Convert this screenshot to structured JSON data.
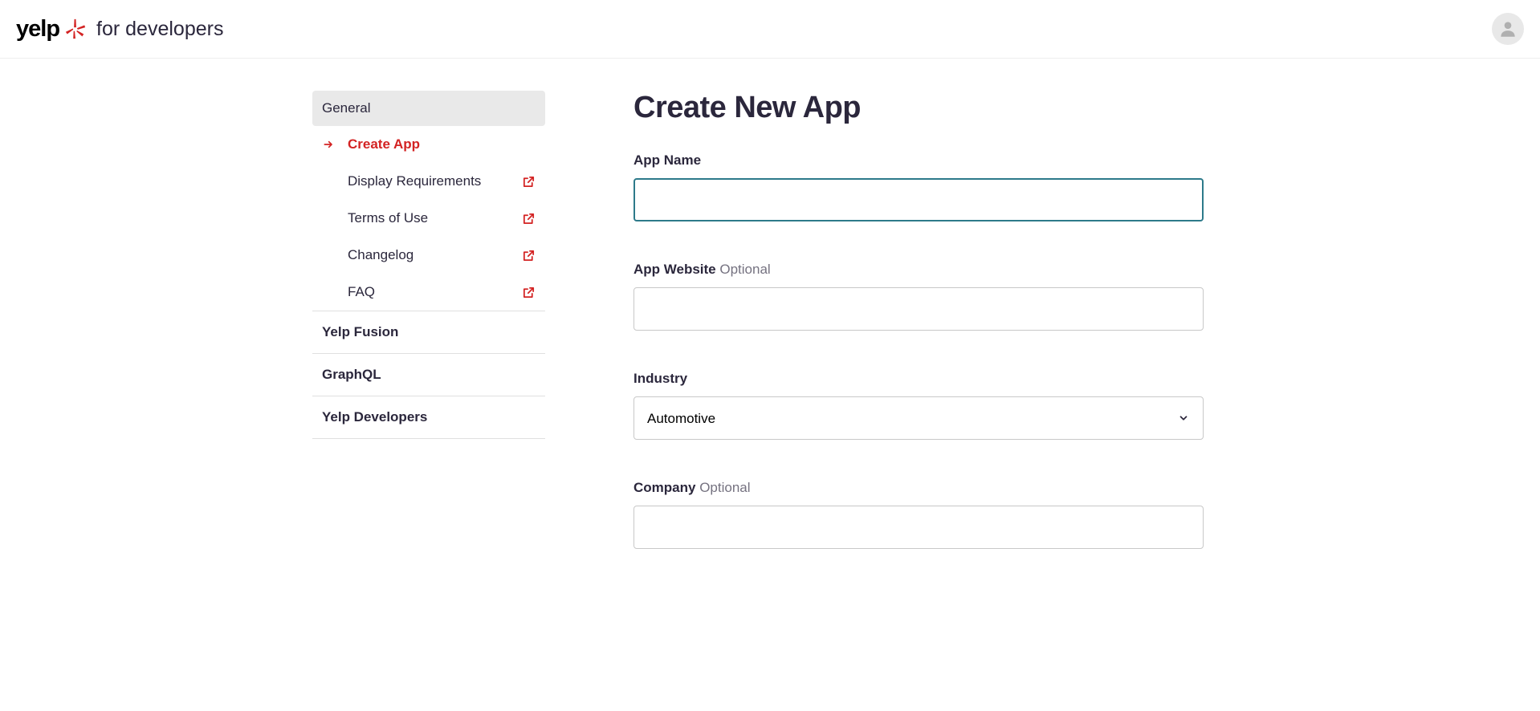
{
  "header": {
    "logo_text": "yelp",
    "tagline": "for developers"
  },
  "sidebar": {
    "section_header": "General",
    "items": [
      {
        "label": "Create App",
        "active": true,
        "external": false
      },
      {
        "label": "Display Requirements",
        "active": false,
        "external": true
      },
      {
        "label": "Terms of Use",
        "active": false,
        "external": true
      },
      {
        "label": "Changelog",
        "active": false,
        "external": true
      },
      {
        "label": "FAQ",
        "active": false,
        "external": true
      }
    ],
    "bottom_items": [
      {
        "label": "Yelp Fusion"
      },
      {
        "label": "GraphQL"
      },
      {
        "label": "Yelp Developers"
      }
    ]
  },
  "main": {
    "title": "Create New App",
    "form": {
      "app_name": {
        "label": "App Name",
        "value": ""
      },
      "app_website": {
        "label": "App Website",
        "optional": "Optional",
        "value": ""
      },
      "industry": {
        "label": "Industry",
        "selected": "Automotive"
      },
      "company": {
        "label": "Company",
        "optional": "Optional",
        "value": ""
      }
    }
  }
}
